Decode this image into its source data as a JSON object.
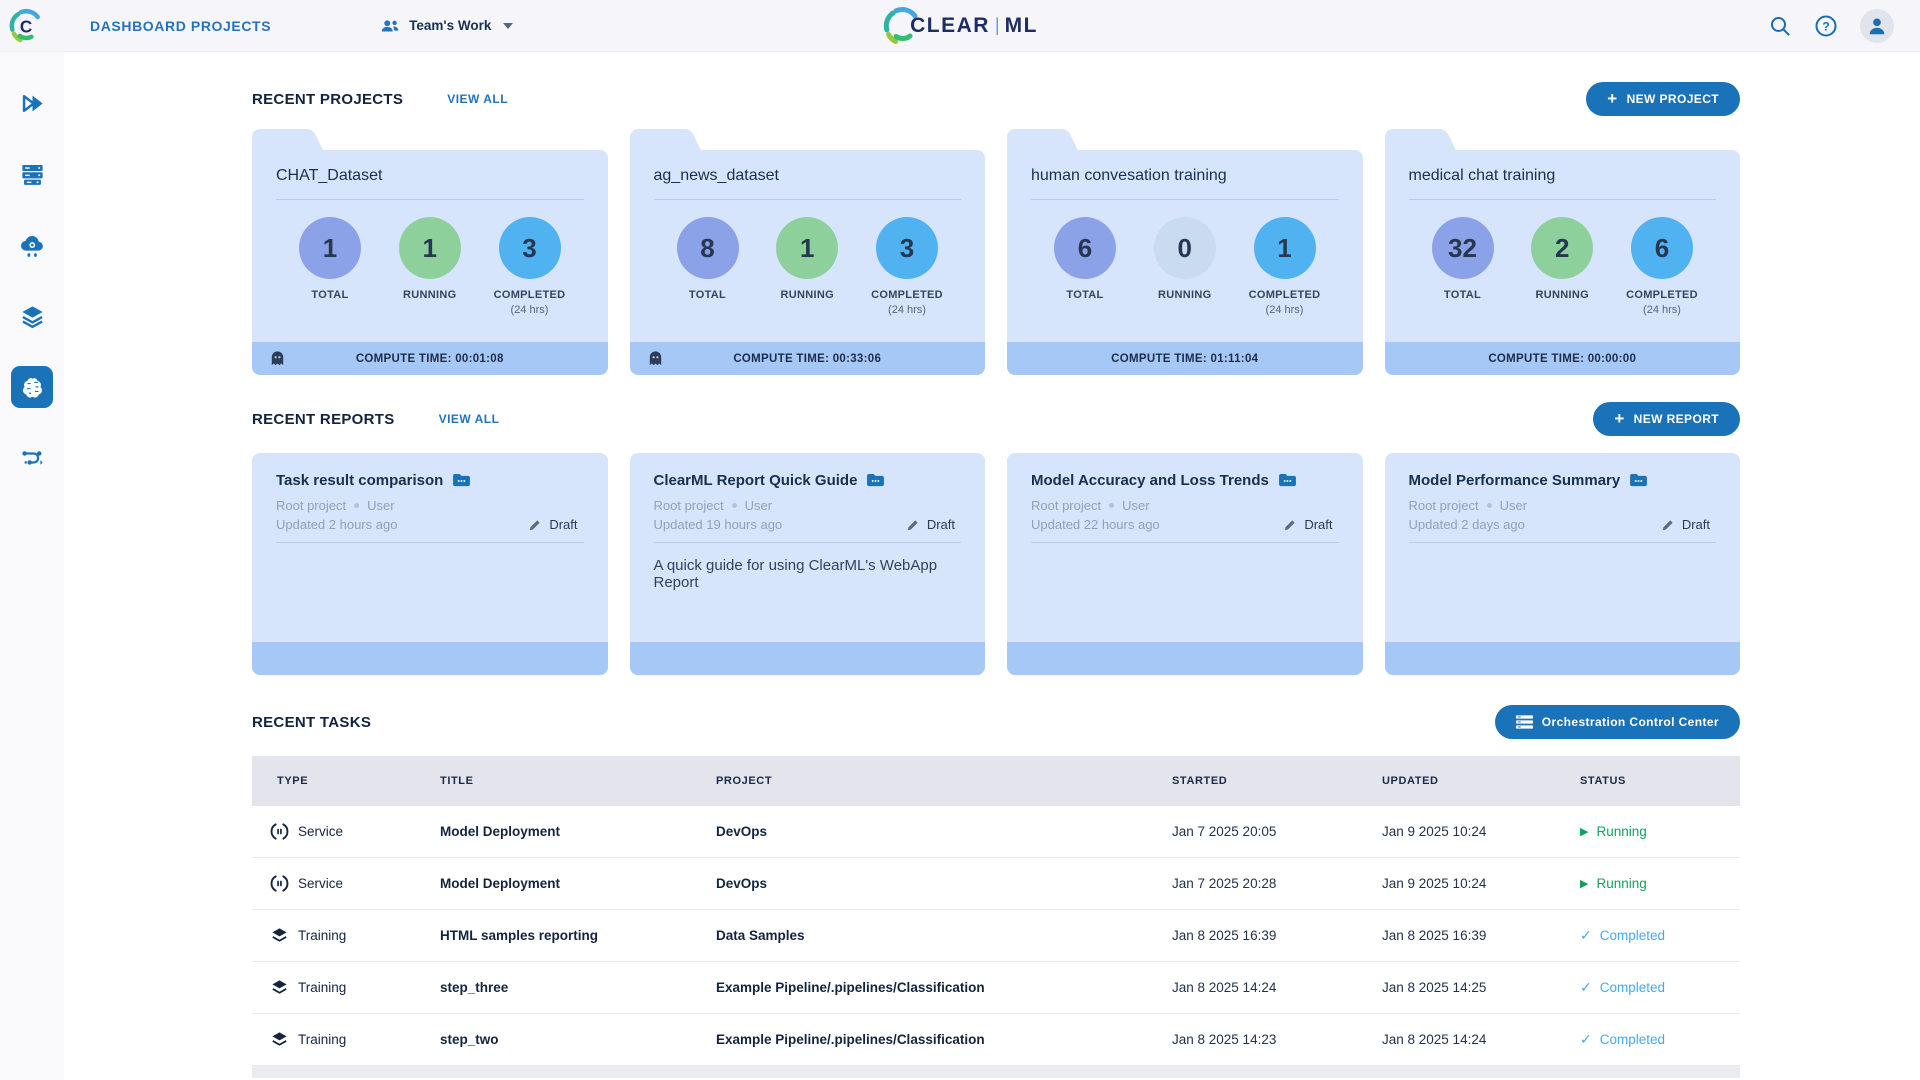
{
  "topbar": {
    "title": "DASHBOARD PROJECTS",
    "workspace": "Team's Work",
    "logo_clear": "CLEAR",
    "logo_sep": "|",
    "logo_ml": "ML"
  },
  "sidebar": {
    "items": [
      {
        "icon": "expand-icon"
      },
      {
        "icon": "queues-icon"
      },
      {
        "icon": "workers-icon"
      },
      {
        "icon": "datasets-icon"
      },
      {
        "icon": "projects-brain-icon",
        "active": true
      },
      {
        "icon": "pipelines-icon"
      }
    ]
  },
  "projects_section": {
    "title": "RECENT PROJECTS",
    "view_all": "VIEW ALL",
    "new_button": "NEW PROJECT",
    "plus": "+",
    "stat_labels": {
      "total": "TOTAL",
      "running": "RUNNING",
      "completed": "COMPLETED",
      "completed_sub": "(24 hrs)"
    },
    "compute_prefix": "COMPUTE TIME: ",
    "cards": [
      {
        "name": "CHAT_Dataset",
        "total": "1",
        "running": "1",
        "completed": "3",
        "compute_time": "00:01:08",
        "has_ghost": true
      },
      {
        "name": "ag_news_dataset",
        "total": "8",
        "running": "1",
        "completed": "3",
        "compute_time": "00:33:06",
        "has_ghost": true
      },
      {
        "name": "human convesation training",
        "total": "6",
        "running": "0",
        "completed": "1",
        "compute_time": "01:11:04",
        "has_ghost": false
      },
      {
        "name": "medical chat training",
        "total": "32",
        "running": "2",
        "completed": "6",
        "compute_time": "00:00:00",
        "has_ghost": false
      }
    ]
  },
  "reports_section": {
    "title": "RECENT REPORTS",
    "view_all": "VIEW ALL",
    "new_button": "NEW REPORT",
    "plus": "+",
    "cards": [
      {
        "title": "Task result comparison",
        "project": "Root project",
        "author": "User",
        "updated": "Updated 2 hours ago",
        "status": "Draft",
        "description": ""
      },
      {
        "title": "ClearML Report Quick Guide",
        "project": "Root project",
        "author": "User",
        "updated": "Updated 19 hours ago",
        "status": "Draft",
        "description": "A quick guide for using ClearML's WebApp Report"
      },
      {
        "title": "Model Accuracy and Loss Trends",
        "project": "Root project",
        "author": "User",
        "updated": "Updated 22 hours ago",
        "status": "Draft",
        "description": ""
      },
      {
        "title": "Model Performance Summary",
        "project": "Root project",
        "author": "User",
        "updated": "Updated 2 days ago",
        "status": "Draft",
        "description": ""
      }
    ]
  },
  "tasks_section": {
    "title": "RECENT TASKS",
    "orchestration_button": "Orchestration Control Center",
    "table": {
      "headers": [
        "TYPE",
        "TITLE",
        "PROJECT",
        "STARTED",
        "UPDATED",
        "STATUS"
      ],
      "rows": [
        {
          "type": "Service",
          "title": "Model Deployment",
          "project": "DevOps",
          "started": "Jan 7 2025 20:05",
          "updated": "Jan 9 2025 10:24",
          "status": "Running"
        },
        {
          "type": "Service",
          "title": "Model Deployment",
          "project": "DevOps",
          "started": "Jan 7 2025 20:28",
          "updated": "Jan 9 2025 10:24",
          "status": "Running"
        },
        {
          "type": "Training",
          "title": "HTML samples reporting",
          "project": "Data Samples",
          "started": "Jan 8 2025 16:39",
          "updated": "Jan 8 2025 16:39",
          "status": "Completed"
        },
        {
          "type": "Training",
          "title": "step_three",
          "project": "Example Pipeline/.pipelines/Classification",
          "started": "Jan 8 2025 14:24",
          "updated": "Jan 8 2025 14:25",
          "status": "Completed"
        },
        {
          "type": "Training",
          "title": "step_two",
          "project": "Example Pipeline/.pipelines/Classification",
          "started": "Jan 8 2025 14:23",
          "updated": "Jan 8 2025 14:24",
          "status": "Completed"
        }
      ]
    }
  },
  "colors": {
    "accent_blue": "#1a72b8",
    "link_blue": "#2573bd",
    "card_bg": "#d6e5fc",
    "card_footer": "#a6c8f7",
    "stat_total": "#8ba2e9",
    "stat_running": "#8ed09b",
    "stat_running_zero": "#c9dbef",
    "stat_completed": "#50b2f0",
    "status_running": "#16a05d",
    "status_completed": "#4aa7ee",
    "logo_navy": "#1d2e63"
  }
}
